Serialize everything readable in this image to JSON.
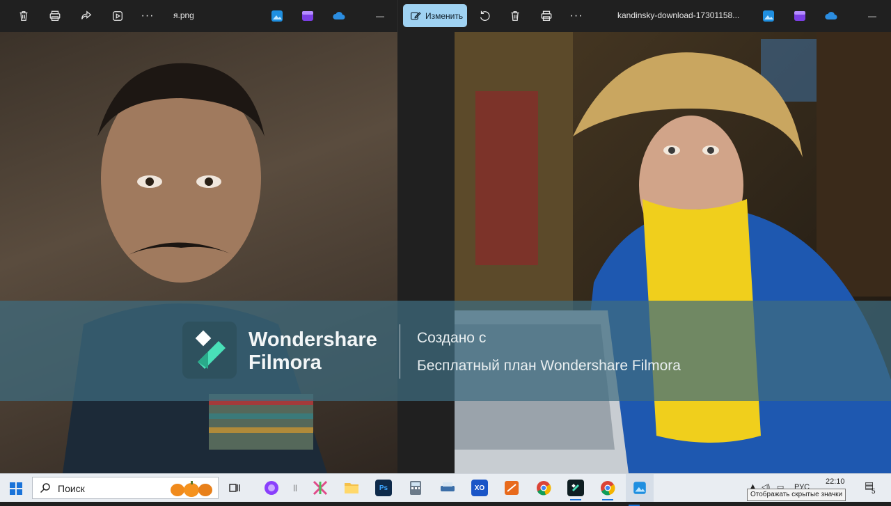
{
  "left_window": {
    "filename": "я.png",
    "toolbar_buttons": [
      "delete-icon",
      "print-icon",
      "share-icon",
      "slideshow-icon",
      "more-icon"
    ],
    "more_label": "···",
    "minimize_label": "—"
  },
  "right_window": {
    "edit_label": "Изменить",
    "filename": "kandinsky-download-17301158...",
    "more_label": "···",
    "minimize_label": "—"
  },
  "watermark": {
    "brand_line1": "Wondershare",
    "brand_line2": "Filmora",
    "caption_line1": "Создано с",
    "caption_line2": "Бесплатный план Wondershare Filmora"
  },
  "taskbar": {
    "search_placeholder": "Поиск",
    "apps": [
      {
        "name": "task-view",
        "label": ""
      },
      {
        "name": "alice",
        "label": ""
      },
      {
        "name": "separator",
        "label": "||"
      },
      {
        "name": "pinned-app",
        "label": ""
      },
      {
        "name": "file-explorer",
        "label": ""
      },
      {
        "name": "photoshop",
        "label": "Ps"
      },
      {
        "name": "calculator",
        "label": ""
      },
      {
        "name": "scanner",
        "label": ""
      },
      {
        "name": "xo-app",
        "label": "XO"
      },
      {
        "name": "pinned-app-2",
        "label": ""
      },
      {
        "name": "chrome",
        "label": ""
      },
      {
        "name": "filmora",
        "label": ""
      },
      {
        "name": "chrome-2",
        "label": ""
      },
      {
        "name": "photos",
        "label": ""
      }
    ],
    "language": "РУС",
    "time": "22:10",
    "notification_count": "5",
    "tooltip": "Отображать скрытые значки"
  },
  "colors": {
    "toolbar_bg": "#202020",
    "edit_button_bg": "#9fd2f2",
    "taskbar_bg": "#e9edf2",
    "banner": "#3e6c80"
  }
}
